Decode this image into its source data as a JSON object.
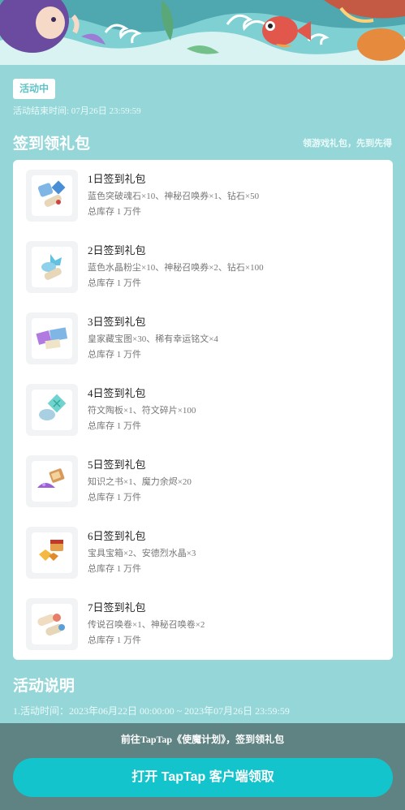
{
  "activity": {
    "status": "活动中",
    "end_time": "活动结束时间: 07月26日 23:59:59"
  },
  "gift_section": {
    "title": "签到领礼包",
    "hint": "领游戏礼包，先到先得",
    "items": [
      {
        "name": "1日签到礼包",
        "desc": "蓝色突破魂石×10、神秘召唤券×1、钻石×50",
        "stock": "总库存 1 万件",
        "icon": "soulstone-scroll-gem-icon"
      },
      {
        "name": "2日签到礼包",
        "desc": "蓝色水晶粉尘×10、神秘召唤券×2、钻石×100",
        "stock": "总库存 1 万件",
        "icon": "crystal-dust-scroll-icon"
      },
      {
        "name": "3日签到礼包",
        "desc": "皇家藏宝图×30、稀有幸运铭文×4",
        "stock": "总库存 1 万件",
        "icon": "treasure-map-inscription-icon"
      },
      {
        "name": "4日签到礼包",
        "desc": "符文陶板×1、符文碎片×100",
        "stock": "总库存 1 万件",
        "icon": "rune-tablet-icon"
      },
      {
        "name": "5日签到礼包",
        "desc": "知识之书×1、魔力余烬×20",
        "stock": "总库存 1 万件",
        "icon": "book-ember-icon"
      },
      {
        "name": "6日签到礼包",
        "desc": "宝具宝箱×2、安德烈水晶×3",
        "stock": "总库存 1 万件",
        "icon": "treasure-chest-crystal-icon"
      },
      {
        "name": "7日签到礼包",
        "desc": "传说召唤卷×1、神秘召唤卷×2",
        "stock": "总库存 1 万件",
        "icon": "summon-scroll-icon"
      }
    ]
  },
  "description": {
    "title": "活动说明",
    "line1": "1.活动时间：2023年06月22日 00:00:00 ~ 2023年07月26日 23:59:59"
  },
  "bottom": {
    "tip": "前往TapTap《使魔计划》，签到领礼包",
    "button_label": "打开 TapTap 客户端领取"
  },
  "colors": {
    "background": "#95d7d8",
    "accent": "#14c4cc",
    "bottom_bar": "#5f8383"
  }
}
